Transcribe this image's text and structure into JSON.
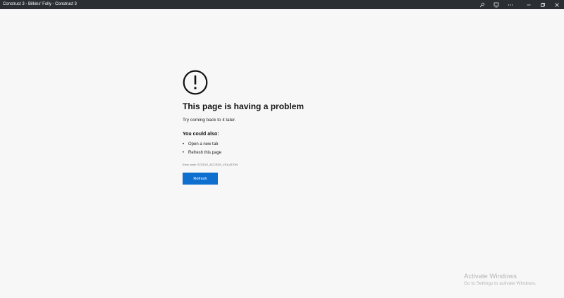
{
  "window": {
    "title": "Construct 3 - Bilkins' Folly - Construct 3",
    "controls": {
      "pin_icon": "pin-icon",
      "cast_icon": "cast-icon",
      "more_icon": "more-icon",
      "minimize_icon": "minimize-icon",
      "restore_icon": "restore-icon",
      "close_icon": "close-icon"
    },
    "titlebar_color": "#2b2f33"
  },
  "error_page": {
    "icon": "alert-circle-icon",
    "heading": "This page is having a problem",
    "subtitle": "Try coming back to it later.",
    "options_heading": "You could also:",
    "options": [
      "Open a new tab",
      "Refresh this page"
    ],
    "error_code": "Error code: STATUS_ACCESS_VIOLATION",
    "refresh_label": "Refresh",
    "accent_color": "#0f6fcf"
  },
  "watermark": {
    "title": "Activate Windows",
    "subtitle": "Go to Settings to activate Windows."
  }
}
